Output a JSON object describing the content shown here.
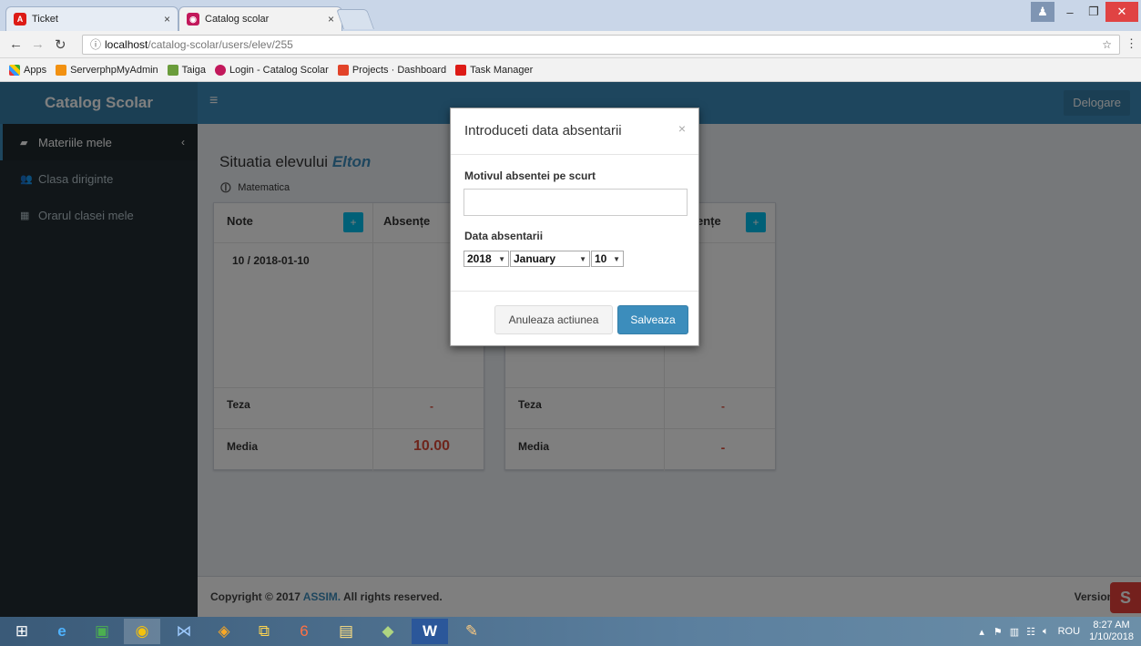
{
  "browser": {
    "tabs": [
      {
        "title": "Ticket",
        "icon": "angular-icon"
      },
      {
        "title": "Catalog scolar",
        "icon": "catalog-icon"
      }
    ],
    "url_host": "localhost",
    "url_path": "/catalog-scolar/users/elev/255",
    "bookmarks": [
      "Apps",
      "ServerphpMyAdmin",
      "Taiga",
      "Login - Catalog Scolar",
      "Projects · Dashboard",
      "Task Manager"
    ]
  },
  "app": {
    "logo": "Catalog Scolar",
    "logout": "Delogare",
    "sidebar": [
      {
        "label": "Materiile mele"
      },
      {
        "label": "Clasa diriginte"
      },
      {
        "label": "Orarul clasei mele"
      }
    ],
    "page_title_prefix": "Situatia elevului",
    "student_name": "Elton",
    "subject": "Matematica",
    "left_card": {
      "col_note": "Note",
      "col_abs": "Absențe",
      "grade": "10 / 2018-01-10",
      "teza_label": "Teza",
      "teza_value": "-",
      "media_label": "Media",
      "media_value": "10.00"
    },
    "right_card": {
      "col_abs": "ențe",
      "teza_label": "Teza",
      "teza_value": "-",
      "media_label": "Media",
      "media_value": "-"
    },
    "footer_prefix": "Copyright © 2017",
    "footer_brand": "ASSIM.",
    "footer_suffix": "All rights reserved.",
    "version": "Version 1"
  },
  "modal": {
    "title": "Introduceti data absentarii",
    "close": "×",
    "reason_label": "Motivul absentei pe scurt",
    "reason_value": "",
    "date_label": "Data absentarii",
    "year": "2018",
    "month": "January",
    "day": "10",
    "cancel": "Anuleaza actiunea",
    "save": "Salveaza"
  },
  "taskbar": {
    "lang": "ROU",
    "time": "8:27 AM",
    "date": "1/10/2018"
  }
}
